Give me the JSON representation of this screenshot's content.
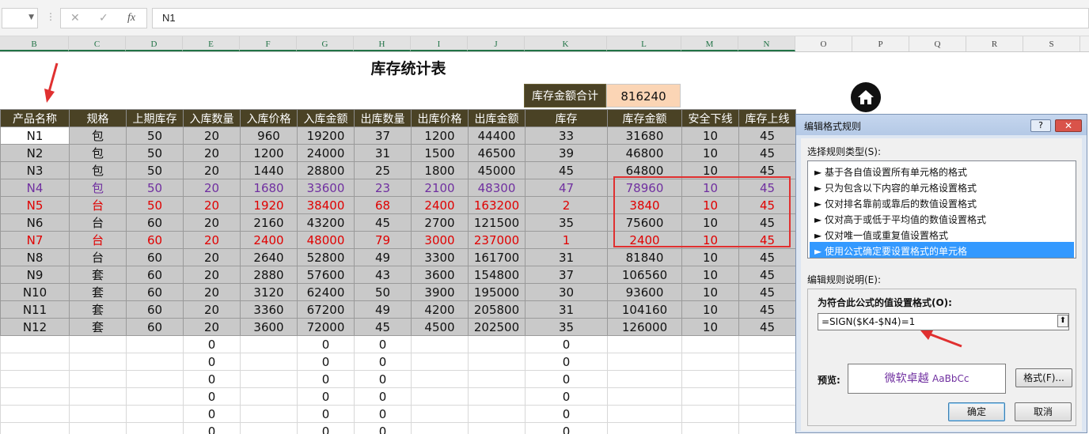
{
  "formula_bar": {
    "cell_ref": "",
    "cancel_icon": "✕",
    "confirm_icon": "✓",
    "fx_label": "fx",
    "formula": "N1"
  },
  "columns": [
    "B",
    "C",
    "D",
    "E",
    "F",
    "G",
    "H",
    "I",
    "J",
    "K",
    "L",
    "M",
    "N",
    "O",
    "P",
    "Q",
    "R",
    "S"
  ],
  "sheet": {
    "title": "库存统计表",
    "summary_label": "库存金额合计",
    "summary_value": "816240",
    "headers": [
      "产品名称",
      "规格",
      "上期库存",
      "入库数量",
      "入库价格",
      "入库金额",
      "出库数量",
      "出库价格",
      "出库金额",
      "库存",
      "库存金额",
      "安全下线",
      "库存上线"
    ],
    "rows": [
      [
        "N1",
        "包",
        "50",
        "20",
        "960",
        "19200",
        "37",
        "1200",
        "44400",
        "33",
        "31680",
        "10",
        "45"
      ],
      [
        "N2",
        "包",
        "50",
        "20",
        "1200",
        "24000",
        "31",
        "1500",
        "46500",
        "39",
        "46800",
        "10",
        "45"
      ],
      [
        "N3",
        "包",
        "50",
        "20",
        "1440",
        "28800",
        "25",
        "1800",
        "45000",
        "45",
        "64800",
        "10",
        "45"
      ],
      [
        "N4",
        "包",
        "50",
        "20",
        "1680",
        "33600",
        "23",
        "2100",
        "48300",
        "47",
        "78960",
        "10",
        "45"
      ],
      [
        "N5",
        "台",
        "50",
        "20",
        "1920",
        "38400",
        "68",
        "2400",
        "163200",
        "2",
        "3840",
        "10",
        "45"
      ],
      [
        "N6",
        "台",
        "60",
        "20",
        "2160",
        "43200",
        "45",
        "2700",
        "121500",
        "35",
        "75600",
        "10",
        "45"
      ],
      [
        "N7",
        "台",
        "60",
        "20",
        "2400",
        "48000",
        "79",
        "3000",
        "237000",
        "1",
        "2400",
        "10",
        "45"
      ],
      [
        "N8",
        "台",
        "60",
        "20",
        "2640",
        "52800",
        "49",
        "3300",
        "161700",
        "31",
        "81840",
        "10",
        "45"
      ],
      [
        "N9",
        "套",
        "60",
        "20",
        "2880",
        "57600",
        "43",
        "3600",
        "154800",
        "37",
        "106560",
        "10",
        "45"
      ],
      [
        "N10",
        "套",
        "60",
        "20",
        "3120",
        "62400",
        "50",
        "3900",
        "195000",
        "30",
        "93600",
        "10",
        "45"
      ],
      [
        "N11",
        "套",
        "60",
        "20",
        "3360",
        "67200",
        "49",
        "4200",
        "205800",
        "31",
        "104160",
        "10",
        "45"
      ],
      [
        "N12",
        "套",
        "60",
        "20",
        "3600",
        "72000",
        "45",
        "4500",
        "202500",
        "35",
        "126000",
        "10",
        "45"
      ]
    ],
    "row_styles": [
      "",
      "",
      "",
      "purple",
      "red",
      "",
      "red",
      "",
      "",
      "",
      "",
      ""
    ],
    "empty_rows": [
      [
        "",
        "",
        "",
        "0",
        "",
        "0",
        "0",
        "",
        "",
        "0",
        "",
        "",
        ""
      ],
      [
        "",
        "",
        "",
        "0",
        "",
        "0",
        "0",
        "",
        "",
        "0",
        "",
        "",
        ""
      ],
      [
        "",
        "",
        "",
        "0",
        "",
        "0",
        "0",
        "",
        "",
        "0",
        "",
        "",
        ""
      ],
      [
        "",
        "",
        "",
        "0",
        "",
        "0",
        "0",
        "",
        "",
        "0",
        "",
        "",
        ""
      ],
      [
        "",
        "",
        "",
        "0",
        "",
        "0",
        "0",
        "",
        "",
        "0",
        "",
        "",
        ""
      ],
      [
        "",
        "",
        "",
        "0",
        "",
        "0",
        "0",
        "",
        "",
        "0",
        "",
        "",
        ""
      ]
    ]
  },
  "dialog": {
    "title": "编辑格式规则",
    "help_label": "?",
    "close_label": "✕",
    "rule_type_label": "选择规则类型(S):",
    "rule_types": [
      "► 基于各自值设置所有单元格的格式",
      "► 只为包含以下内容的单元格设置格式",
      "► 仅对排名靠前或靠后的数值设置格式",
      "► 仅对高于或低于平均值的数值设置格式",
      "► 仅对唯一值或重复值设置格式",
      "► 使用公式确定要设置格式的单元格"
    ],
    "selected_rule": 5,
    "desc_label": "编辑规则说明(E):",
    "formula_label": "为符合此公式的值设置格式(O):",
    "formula_value": "=SIGN($K4-$N4)=1",
    "preview_label": "预览:",
    "preview_text_cn": "微软卓越",
    "preview_text_en": "AaBbCc",
    "format_button": "格式(F)...",
    "ok_button": "确定",
    "cancel_button": "取消"
  },
  "colors": {
    "header_bg": "#4a4225",
    "summary_bg": "#fbd5b5",
    "data_bg": "#c9c9c9",
    "highlight_purple": "#7030a0",
    "highlight_red": "#e00000",
    "selection_blue": "#3399ff"
  }
}
